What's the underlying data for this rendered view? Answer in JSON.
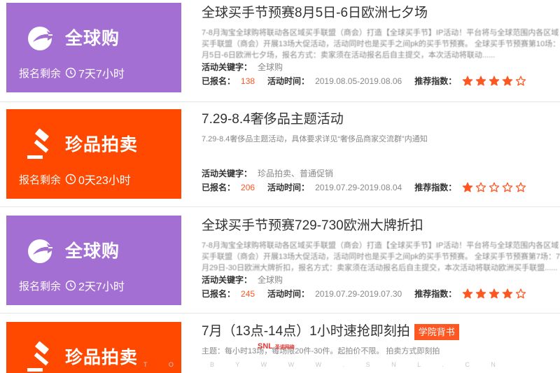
{
  "activities": [
    {
      "theme": "purple",
      "banner_title": "全球购",
      "banner_icon": "globe-arrow-icon",
      "remain_label": "报名剩余",
      "remain_time": "7天7小时",
      "title": "全球买手节预赛8月5日-6日欧洲七夕场",
      "tag": "",
      "desc": "7-8月淘宝全球购将联动各区域买手联盟（商会）打造【全球买手节】IP活动！平台将与全球范围内各区域买手联盟（商会）开展13场大促活动，活动同时也是买手之间pk的买手节预赛。 全球买手节预赛第10场：8月5日-6日欧洲七夕场，报名方式：卖家须在活动报名后自主提交，本次活动将联动......",
      "keyword_label": "活动关键字：",
      "keywords": "全球购",
      "registered_label": "已报名：",
      "registered": "138",
      "time_label": "活动时间：",
      "time": "2019.08.05-2019.08.06",
      "rating_label": "推荐指数：",
      "rating": 4
    },
    {
      "theme": "orange",
      "banner_title": "珍品拍卖",
      "banner_icon": "gavel-icon",
      "remain_label": "报名剩余",
      "remain_time": "0天23小时",
      "title": "7.29-8.4奢侈品主题活动",
      "tag": "",
      "desc": "7.29-8.4奢侈品主题活动，具体要求详见“奢侈品商家交流群”内通知",
      "keyword_label": "活动关键字：",
      "keywords": "珍品拍卖、普通促销",
      "registered_label": "已报名：",
      "registered": "206",
      "time_label": "活动时间：",
      "time": "2019.07.29-2019.08.04",
      "rating_label": "推荐指数：",
      "rating": 1
    },
    {
      "theme": "purple",
      "banner_title": "全球购",
      "banner_icon": "globe-arrow-icon",
      "remain_label": "报名剩余",
      "remain_time": "2天7小时",
      "title": "全球买手节预赛729-730欧洲大牌折扣",
      "tag": "",
      "desc": "7-8月淘宝全球购将联动各区域买手联盟（商会）打造【全球买手节】IP活动！平台将与全球范围内各区域买手联盟（商会）开展13场大促活动，活动同时也是买手之间pk的买手节预赛。 全球买手节预赛第7场：7月29日-30日欧洲大牌折扣，报名方式：卖家须在活动报名后自主提交，本次活动将联动欧洲买手联盟......",
      "keyword_label": "活动关键字：",
      "keywords": "全球购",
      "registered_label": "已报名：",
      "registered": "245",
      "time_label": "活动时间：",
      "time": "2019.07.29-2019.07.30",
      "rating_label": "推荐指数：",
      "rating": 4
    },
    {
      "theme": "orange",
      "banner_title": "珍品拍卖",
      "banner_icon": "gavel-icon",
      "remain_label": "",
      "remain_time": "",
      "title": "7月（13点-14点）1小时速抢即刻拍",
      "tag": "学院背书",
      "desc": "主题：每小时13场，每场限20件-30件。起拍价不限。 拍卖方式即刻拍",
      "keyword_label": "",
      "keywords": "",
      "registered_label": "",
      "registered": "",
      "time_label": "",
      "time": "",
      "rating_label": "",
      "rating": 0
    }
  ],
  "watermark": {
    "logo": "SNL",
    "logo_sub": "圣诺网络",
    "line_left": "B Y W W W . S N L . C N",
    "line_right": "T O"
  },
  "colors": {
    "purple": "#a36fd3",
    "orange": "#ff4800",
    "accent": "#ff5722",
    "star_filled": "#ff5722"
  }
}
